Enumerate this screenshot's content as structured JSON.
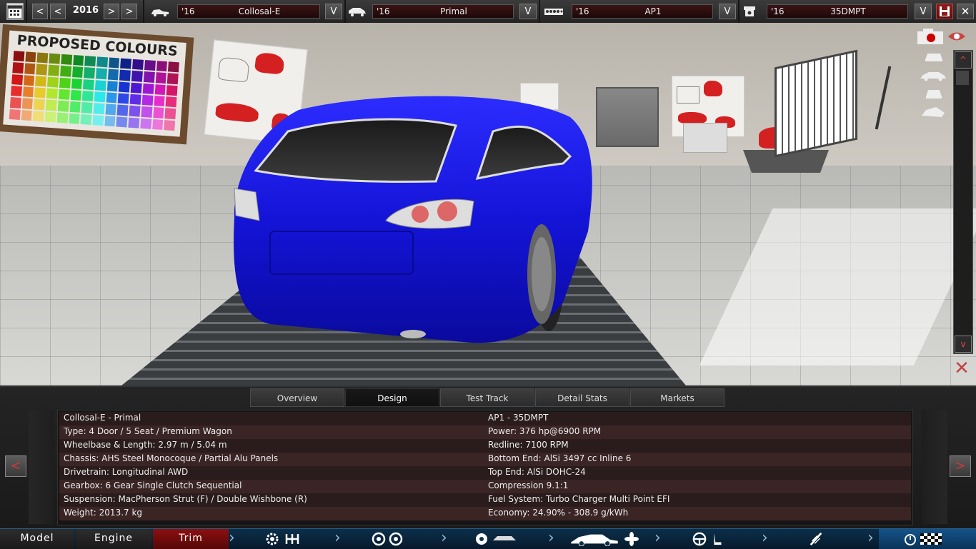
{
  "toolbar": {
    "year": "2016",
    "prev_arrow": "<",
    "next_arrow": ">",
    "dropdown_arrow": "V",
    "selectors": [
      {
        "icon": "car-body-icon",
        "year": "'16",
        "name": "Collosal-E"
      },
      {
        "icon": "car-trim-icon",
        "year": "'16",
        "name": "Primal"
      },
      {
        "icon": "engine-block-icon",
        "year": "'16",
        "name": "AP1"
      },
      {
        "icon": "engine-variant-icon",
        "year": "'16",
        "name": "35DMPT"
      }
    ]
  },
  "scene": {
    "poster_title": "PROPOSED COLOURS",
    "scroll_up": "^",
    "scroll_down": "v",
    "close": "✕"
  },
  "tabs": [
    "Overview",
    "Design",
    "Test Track",
    "Detail Stats",
    "Markets"
  ],
  "active_tab": "Design",
  "stats": {
    "left": [
      "Collosal-E - Primal",
      "Type: 4 Door / 5 Seat / Premium Wagon",
      "Wheelbase & Length: 2.97 m / 5.04 m",
      "Chassis: AHS Steel Monocoque / Partial Alu Panels",
      "Drivetrain: Longitudinal AWD",
      "Gearbox: 6 Gear Single Clutch Sequential",
      "Suspension: MacPherson Strut (F) / Double Wishbone (R)",
      "Weight: 2013.7 kg"
    ],
    "right": [
      "AP1 - 35DMPT",
      "Power: 376 hp@6900 RPM",
      "Redline: 7100 RPM",
      "Bottom End: AlSi 3497 cc Inline 6",
      "Top End: AlSi DOHC-24",
      "Compression 9.1:1",
      "Fuel System: Turbo Charger Multi Point EFI",
      "Economy: 24.90% - 308.9 g/kWh"
    ]
  },
  "panel_nav": {
    "left": "<",
    "right": ">"
  },
  "bottom_nav": {
    "model": "Model",
    "engine": "Engine",
    "trim": "Trim"
  },
  "colors": {
    "car_body": "#1414d8",
    "accent_red": "#8c1010",
    "nav_blue": "#0c2f4a"
  }
}
